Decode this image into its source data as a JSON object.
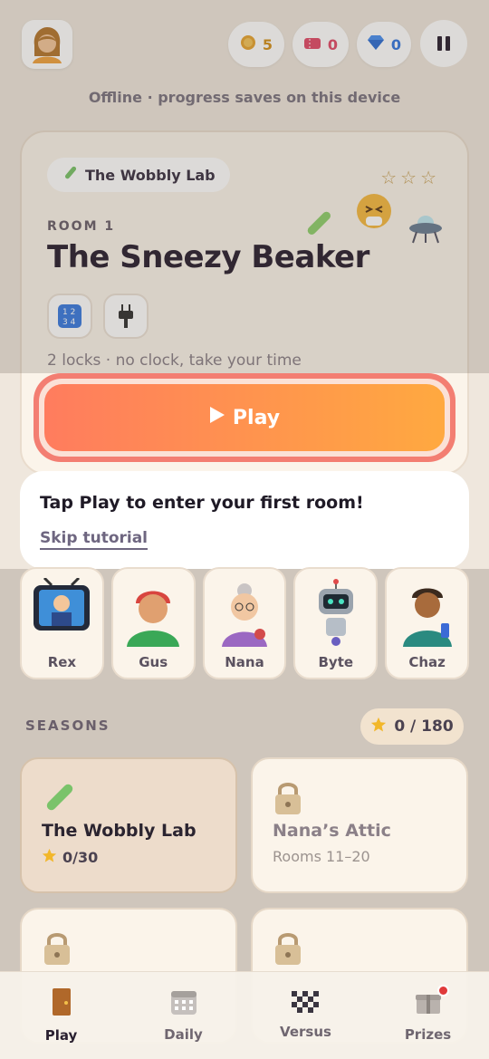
{
  "header": {
    "avatar_label": "Profile avatar",
    "coins": "5",
    "tickets": "0",
    "gems": "0",
    "offline_text": "Offline · progress saves on this device"
  },
  "room": {
    "season_name": "The Wobbly Lab",
    "stars": "☆☆☆",
    "label": "ROOM 1",
    "title": "The Sneezy Beaker",
    "meta": "2 locks · no clock, take your time",
    "lock_icons": [
      "number-pad-icon",
      "plug-icon"
    ],
    "play_label": "Play"
  },
  "tutorial": {
    "title": "Tap Play to enter your first room!",
    "skip": "Skip tutorial"
  },
  "characters": [
    {
      "name": "Rex"
    },
    {
      "name": "Gus"
    },
    {
      "name": "Nana"
    },
    {
      "name": "Byte"
    },
    {
      "name": "Chaz"
    }
  ],
  "seasons": {
    "label": "SEASONS",
    "star_total": "0 / 180",
    "cards": [
      {
        "title": "The Wobbly Lab",
        "sub": "0/30"
      },
      {
        "title": "Nana’s Attic",
        "sub": "Rooms 11–20"
      }
    ]
  },
  "tabs": [
    {
      "label": "Play"
    },
    {
      "label": "Daily"
    },
    {
      "label": "Versus"
    },
    {
      "label": "Prizes"
    }
  ],
  "colors": {
    "play_start": "#ff7c5e",
    "play_end": "#ffa940",
    "background": "#efe7dd",
    "badge": "#e03a3a"
  }
}
